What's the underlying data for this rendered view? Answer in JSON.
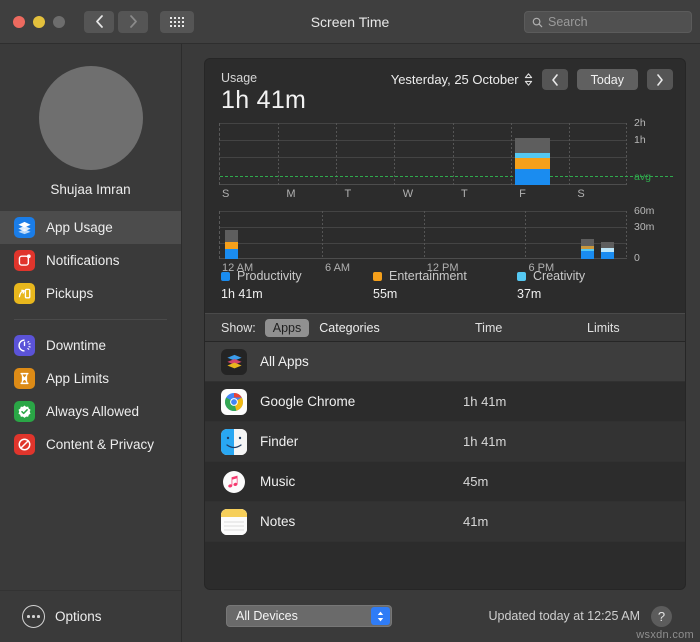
{
  "window": {
    "title": "Screen Time",
    "search_placeholder": "Search"
  },
  "sidebar": {
    "user_name": "Shujaa Imran",
    "items": [
      {
        "label": "App Usage",
        "icon": "layers-icon",
        "color": "#1a7de8",
        "active": true
      },
      {
        "label": "Notifications",
        "icon": "notification-icon",
        "color": "#e0352c",
        "active": false
      },
      {
        "label": "Pickups",
        "icon": "pickup-icon",
        "color": "#e8b71d",
        "active": false
      },
      {
        "label": "Downtime",
        "icon": "downtime-icon",
        "color": "#5b53d8",
        "active": false
      },
      {
        "label": "App Limits",
        "icon": "hourglass-icon",
        "color": "#dd8b16",
        "active": false
      },
      {
        "label": "Always Allowed",
        "icon": "check-badge-icon",
        "color": "#2aa646",
        "active": false
      },
      {
        "label": "Content & Privacy",
        "icon": "no-entry-icon",
        "color": "#e0352c",
        "active": false
      }
    ],
    "options_label": "Options"
  },
  "usage": {
    "label": "Usage",
    "total": "1h 41m",
    "date": "Yesterday, 25 October",
    "today_label": "Today"
  },
  "chart_data": [
    {
      "type": "bar",
      "id": "weekly-usage-chart",
      "title": "",
      "stacked": true,
      "categories": [
        "S",
        "M",
        "T",
        "W",
        "T",
        "F",
        "S"
      ],
      "series": [
        {
          "name": "Productivity",
          "color": "#1a8cf0",
          "values": [
            0,
            0,
            0,
            0,
            0,
            41,
            0
          ]
        },
        {
          "name": "Entertainment",
          "color": "#f5a01b",
          "values": [
            0,
            0,
            0,
            0,
            0,
            28,
            0
          ]
        },
        {
          "name": "Creativity",
          "color": "#55c8f2",
          "values": [
            0,
            0,
            0,
            0,
            0,
            12,
            0
          ]
        },
        {
          "name": "Other",
          "color": "#5e5e5e",
          "values": [
            0,
            0,
            0,
            0,
            0,
            40,
            0
          ]
        }
      ],
      "ytick_labels": [
        "2h",
        "1h"
      ],
      "ylim": [
        0,
        135
      ],
      "ytick_values": [
        120,
        60
      ],
      "average_line": {
        "label": "avg",
        "value": 41,
        "color": "#2faa4d"
      },
      "grid": true,
      "xlabel": "",
      "ylabel": ""
    },
    {
      "type": "bar",
      "id": "hourly-usage-chart",
      "title": "",
      "stacked": true,
      "x": [
        "12 AM",
        "6 AM",
        "12 PM",
        "6 PM"
      ],
      "ytick_labels": [
        "60m",
        "30m",
        "0"
      ],
      "ytick_values": [
        60,
        30,
        0
      ],
      "ylim": [
        0,
        60
      ],
      "bars": [
        {
          "hour": 0,
          "left_pct": 1.2,
          "segments": [
            {
              "name": "Productivity",
              "color": "#1a8cf0",
              "value": 12
            },
            {
              "name": "Entertainment",
              "color": "#f5a01b",
              "value": 9
            },
            {
              "name": "Other",
              "color": "#5e5e5e",
              "value": 15
            }
          ]
        },
        {
          "hour": 22,
          "left_pct": 89.0,
          "segments": [
            {
              "name": "Productivity",
              "color": "#1a8cf0",
              "value": 10
            },
            {
              "name": "Creativity",
              "color": "#55c8f2",
              "value": 3
            },
            {
              "name": "Entertainment",
              "color": "#c9973c",
              "value": 3
            },
            {
              "name": "Other",
              "color": "#5e5e5e",
              "value": 8
            }
          ]
        },
        {
          "hour": 23,
          "left_pct": 94.0,
          "segments": [
            {
              "name": "Productivity",
              "color": "#1a8cf0",
              "value": 9
            },
            {
              "name": "Creativity",
              "color": "#bde6f8",
              "value": 5
            },
            {
              "name": "Other",
              "color": "#5e5e5e",
              "value": 8
            }
          ]
        }
      ],
      "grid": true,
      "xlabel": "",
      "ylabel": ""
    }
  ],
  "legend": [
    {
      "name": "Productivity",
      "value": "1h 41m",
      "color": "#1a8cf0"
    },
    {
      "name": "Entertainment",
      "value": "55m",
      "color": "#f5a01b"
    },
    {
      "name": "Creativity",
      "value": "37m",
      "color": "#55c8f2"
    }
  ],
  "table": {
    "show_label": "Show:",
    "tabs": [
      {
        "label": "Apps",
        "selected": true
      },
      {
        "label": "Categories",
        "selected": false
      }
    ],
    "col_time": "Time",
    "col_limits": "Limits",
    "rows": [
      {
        "name": "All Apps",
        "time": "",
        "icon": "all-apps-icon"
      },
      {
        "name": "Google Chrome",
        "time": "1h 41m",
        "icon": "chrome-icon"
      },
      {
        "name": "Finder",
        "time": "1h 41m",
        "icon": "finder-icon"
      },
      {
        "name": "Music",
        "time": "45m",
        "icon": "music-icon"
      },
      {
        "name": "Notes",
        "time": "41m",
        "icon": "notes-icon"
      }
    ]
  },
  "footer": {
    "device_filter": "All Devices",
    "updated": "Updated today at 12:25 AM",
    "help_label": "?"
  },
  "watermark": "wsxdn.com"
}
